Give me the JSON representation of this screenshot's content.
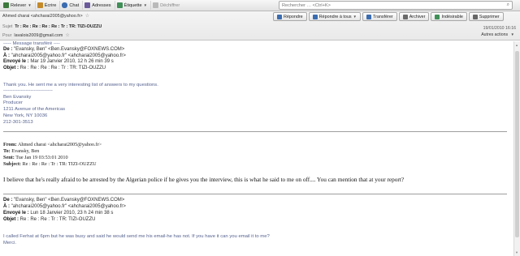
{
  "toolbar": {
    "items": [
      {
        "label": "Relever",
        "icon": "download-icon",
        "color": "#3d7a3d",
        "dropdown": true
      },
      {
        "label": "Écrire",
        "icon": "pencil-icon",
        "color": "#c48a2a",
        "dropdown": false
      },
      {
        "label": "Chat",
        "icon": "chat-icon",
        "color": "#3b6cb0",
        "dropdown": false
      },
      {
        "label": "Adresses",
        "icon": "address-book-icon",
        "color": "#6a5a9a",
        "dropdown": false
      },
      {
        "label": "Étiquette",
        "icon": "tag-icon",
        "color": "#3f8f57",
        "dropdown": true
      },
      {
        "label": "Déchiffrer",
        "icon": "key-icon",
        "color": "#9a9a9a",
        "dropdown": false
      }
    ],
    "search_placeholder": "Rechercher … <Ctrl+K>"
  },
  "header": {
    "from_value": "Ahmed charai <ahcharai2005@yahoo.fr>",
    "subject_label": "Sujet",
    "subject_value": "Tr : Re : Re : Re : Re : Tr : TR: TIZI-OUZZU",
    "to_label": "Pour",
    "to_value": "lavalois2009@gmail.com",
    "actions": [
      {
        "label": "Répondre",
        "icon": "reply-icon",
        "color": "#3b6cb0"
      },
      {
        "label": "Répondre à tous",
        "icon": "reply-all-icon",
        "color": "#3b6cb0",
        "dropdown": true
      },
      {
        "label": "Transférer",
        "icon": "forward-icon",
        "color": "#3b6cb0"
      },
      {
        "label": "Archiver",
        "icon": "archive-icon",
        "color": "#6a6a6a"
      },
      {
        "label": "Indésirable",
        "icon": "junk-icon",
        "color": "#3f8f57"
      },
      {
        "label": "Supprimer",
        "icon": "trash-icon",
        "color": "#666666"
      }
    ],
    "date": "19/01/2010 16:16",
    "other_actions": "Autres actions"
  },
  "body": {
    "forward_marker": "----- Message transféré ----",
    "msg1": {
      "de": "\"Evansky, Ben\" <Ben.Evansky@FOXNEWS.COM>",
      "a": "\"ahcharai2005@yahoo.fr\" <ahcharai2005@yahoo.fr>",
      "envoye": "Mar 19 Janvier 2010, 12 h 26 min 39 s",
      "objet": "Re : Re : Re : Re : Tr : TR: TIZI-OUZZU",
      "text": "Thank you. He sent me a very interesting list of answers to my questions.",
      "dashes": "-------------------------------",
      "sig": [
        "Ben Evansky",
        "Producer",
        "1211 Avenue of the Americas",
        "New York, NY 10036",
        "212-301-3513"
      ]
    },
    "labels_fr": {
      "de": "De :",
      "a": "À :",
      "envoye": "Envoyé le :",
      "objet": "Objet :"
    },
    "labels_en": {
      "from": "From:",
      "to": "To:",
      "sent": "Sent:",
      "subject": "Subject:"
    },
    "msg2": {
      "from": "Ahmed charai <ahcharai2005@yahoo.fr>",
      "to": "Evansky, Ben",
      "sent": "Tue Jan 19 03:53:01 2010",
      "subject": "Re : Re : Re : Tr : TR: TIZI-OUZZU",
      "text": "I believe that he's really afraid to be arrested by the Algerian police if he gives you the interview, this is what he said to me on off.... You can mention that at your report?"
    },
    "msg3": {
      "de": "\"Evansky, Ben\" <Ben.Evansky@FOXNEWS.COM>",
      "a": "\"ahcharai2005@yahoo.fr\" <ahcharai2005@yahoo.fr>",
      "envoye": "Lun 18 Janvier 2010, 23 h 24 min 38 s",
      "objet": "Re : Re : Re : Tr : TR: TIZI-OUZZU",
      "text": "I called Ferhat at 6pm but he was busy and said he would send me his email-he has not. If you have it can you email it to me?",
      "closing": "Merci."
    }
  }
}
